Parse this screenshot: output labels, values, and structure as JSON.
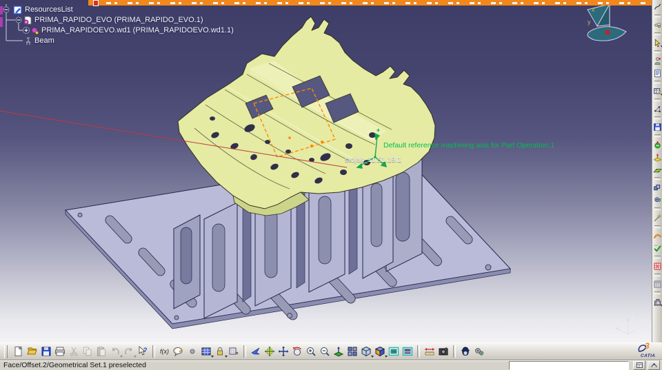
{
  "top_bar": {
    "note": "partially visible selected tree node",
    "color": "#f2871c"
  },
  "tree": {
    "items": [
      {
        "label": "ResourcesList",
        "icon": "resources-list-icon"
      },
      {
        "label": "PRIMA_RAPIDO_EVO (PRIMA_RAPIDO_EVO.1)",
        "icon": "process-product-icon"
      },
      {
        "label": "PRIMA_RAPIDOEVO.wd1 (PRIMA_RAPIDOEVO.wd1.1)",
        "icon": "workcell-icon"
      },
      {
        "label": "Beam",
        "icon": "beam-icon"
      }
    ]
  },
  "viewport": {
    "machining_axis_note": "Default reference machining axis for Part Operation.1",
    "part_label": "stojak_11.51.19.1",
    "compass": {
      "x": "x",
      "y": "y"
    },
    "triad": {
      "z": "z"
    },
    "colors": {
      "part_yellow": "#e5eba3",
      "fixture_lavender": "#b6b8d6",
      "preselect_red": "#c03a3a",
      "annotation_green": "#00bf4e",
      "selection_orange": "#ff8a00"
    }
  },
  "right_toolbar": {
    "items": [
      {
        "name": "curve-tool-button",
        "glyph": "topcut"
      },
      {
        "sep": true
      },
      {
        "name": "fly-insect-button",
        "glyph": "flybug"
      },
      {
        "sep": true
      },
      {
        "name": "select-button",
        "glyph": "cursor",
        "dd": true
      },
      {
        "sep": true
      },
      {
        "name": "knowledge-button",
        "glyph": "knowledge"
      },
      {
        "name": "report-list-button",
        "glyph": "doclines"
      },
      {
        "sep": true
      },
      {
        "name": "design-table-button",
        "glyph": "designtbl",
        "dd": true
      },
      {
        "sep": true
      },
      {
        "name": "axis-structure-button",
        "glyph": "molecule"
      },
      {
        "sep": true
      },
      {
        "name": "save-data-button",
        "glyph": "disk2"
      },
      {
        "sep": true
      },
      {
        "name": "machining-operation-green-button",
        "glyph": "opgreen"
      },
      {
        "name": "machining-operation-yellow-button",
        "glyph": "opyellow"
      },
      {
        "name": "facing-operation-button",
        "glyph": "facing"
      },
      {
        "sep": true
      },
      {
        "name": "product-structure-button",
        "glyph": "cubes"
      },
      {
        "name": "gear-sync-button",
        "glyph": "gearsync"
      },
      {
        "sep": true
      },
      {
        "name": "wand-button",
        "glyph": "wand"
      },
      {
        "sep": true
      },
      {
        "name": "measure-curve-button",
        "glyph": "curveruler"
      },
      {
        "name": "check-ok-button",
        "glyph": "checkok"
      },
      {
        "sep": true
      },
      {
        "name": "nc-table-button",
        "glyph": "redgrid"
      },
      {
        "sep": true
      },
      {
        "name": "grid-table-button",
        "glyph": "gridtbl"
      },
      {
        "sep": true
      },
      {
        "name": "machine-tool-button",
        "glyph": "machine",
        "dd": true
      }
    ]
  },
  "bottom_toolbar": {
    "items": [
      {
        "name": "new-document-button",
        "glyph": "new"
      },
      {
        "name": "open-button",
        "glyph": "open"
      },
      {
        "name": "save-button",
        "glyph": "save"
      },
      {
        "name": "print-button",
        "glyph": "print"
      },
      {
        "name": "cut-button",
        "glyph": "cut",
        "dis": true
      },
      {
        "name": "copy-button",
        "glyph": "copy",
        "dis": true
      },
      {
        "name": "paste-button",
        "glyph": "paste",
        "dis": true
      },
      {
        "name": "undo-button",
        "glyph": "undo",
        "dis": true,
        "dd": true
      },
      {
        "name": "redo-button",
        "glyph": "redo",
        "dis": true,
        "dd": true
      },
      {
        "name": "whats-this-button",
        "glyph": "whatsthis"
      },
      {
        "sep": true
      },
      {
        "name": "formula-button",
        "glyph": "fx"
      },
      {
        "name": "comment-button",
        "glyph": "comment"
      },
      {
        "name": "badge-button",
        "glyph": "badge"
      },
      {
        "name": "table-button",
        "glyph": "tableblue",
        "dd": true
      },
      {
        "name": "lock-button",
        "glyph": "lock",
        "dd": true
      },
      {
        "name": "design-table-button",
        "glyph": "dtable"
      },
      {
        "sep": true
      },
      {
        "name": "fly-mode-button",
        "glyph": "fly"
      },
      {
        "name": "fit-all-in-button",
        "glyph": "fitall"
      },
      {
        "name": "pan-button",
        "glyph": "pan"
      },
      {
        "name": "rotate-button",
        "glyph": "rotate"
      },
      {
        "name": "zoom-in-button",
        "glyph": "zoomin"
      },
      {
        "name": "zoom-out-button",
        "glyph": "zoomout"
      },
      {
        "name": "normal-view-button",
        "glyph": "normalview"
      },
      {
        "name": "multi-view-button",
        "glyph": "multiview"
      },
      {
        "name": "iso-view-button",
        "glyph": "isocube",
        "dd": true
      },
      {
        "name": "shading-mode-button",
        "glyph": "shadecube",
        "dd": true
      },
      {
        "name": "hide-show-button",
        "glyph": "viewmode"
      },
      {
        "name": "swap-visible-space-button",
        "glyph": "viewmode2"
      },
      {
        "sep": true
      },
      {
        "name": "measure-between-button",
        "glyph": "measure"
      },
      {
        "name": "capture-button",
        "glyph": "capture"
      },
      {
        "sep": true
      },
      {
        "name": "penguin-tool-button",
        "glyph": "penguin"
      },
      {
        "name": "gear-tool-button",
        "glyph": "gears"
      }
    ]
  },
  "status_bar": {
    "message": "Face/Offset.2/Geometrical Set.1 preselected",
    "input_value": ""
  },
  "brand": {
    "mark": "3",
    "name": "CATIA"
  }
}
